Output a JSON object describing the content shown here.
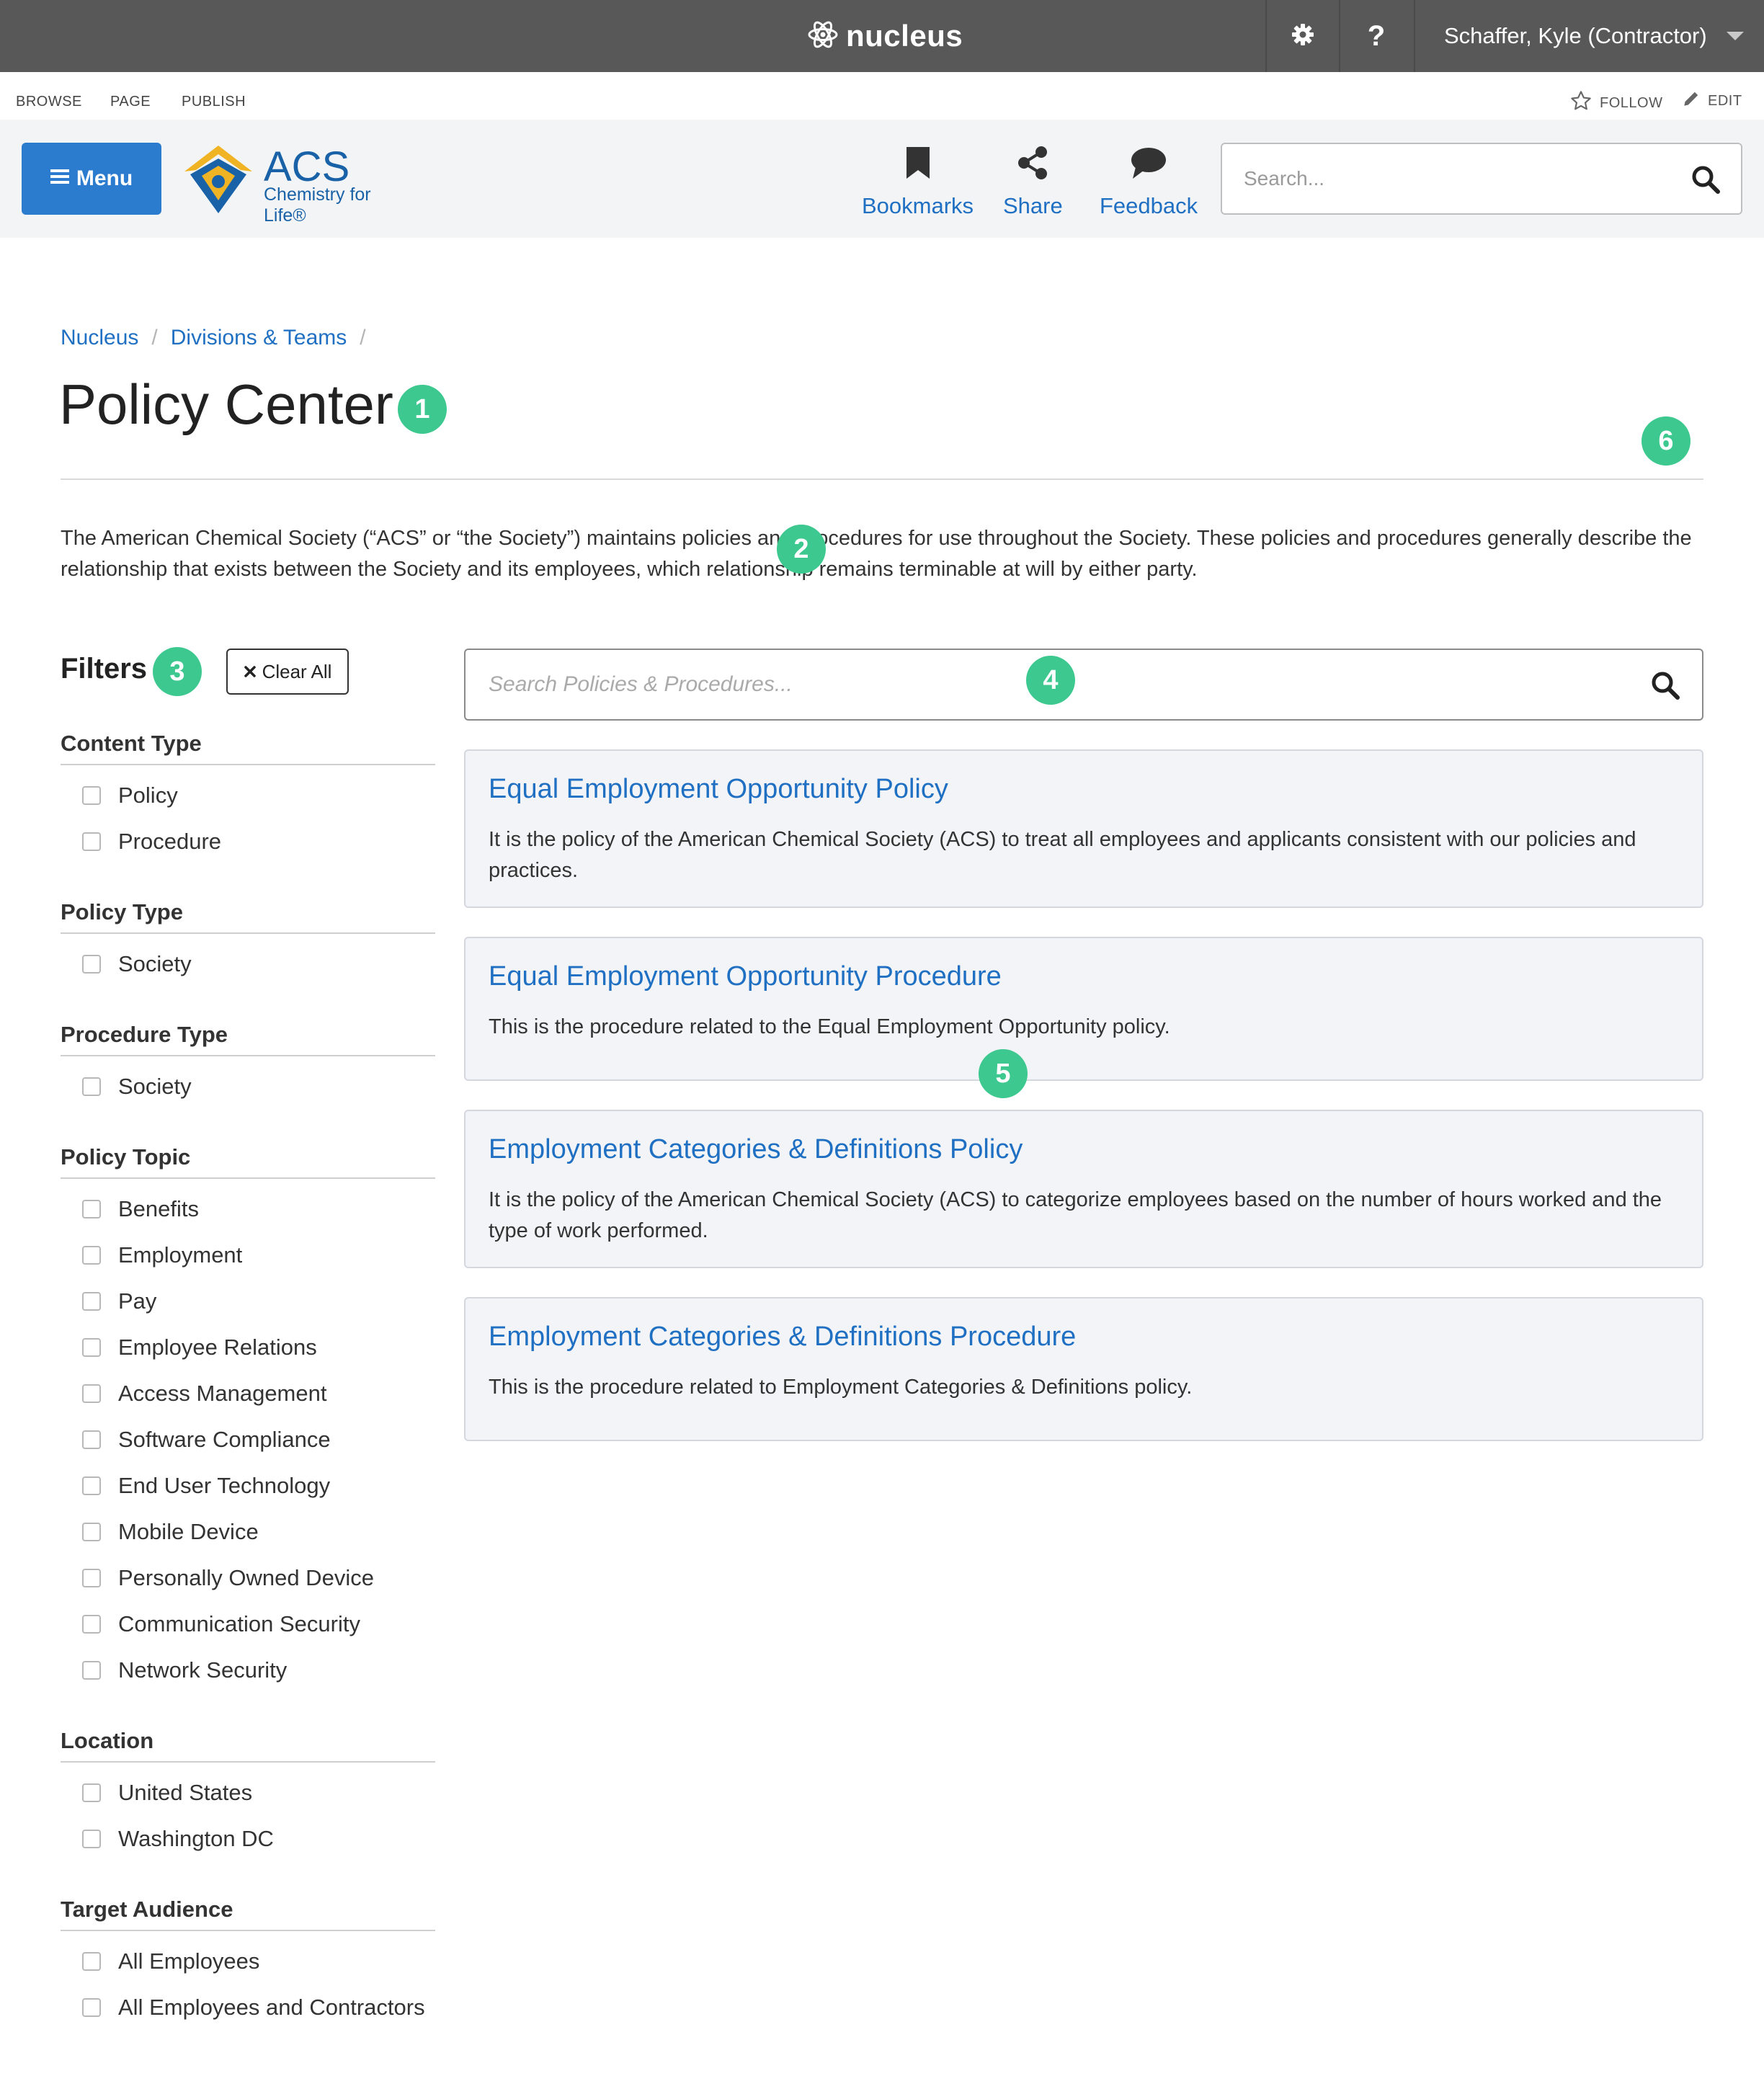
{
  "topbar": {
    "brand": "nucleus",
    "user": "Schaffer, Kyle (Contractor)"
  },
  "ribbon": {
    "browse": "BROWSE",
    "page": "PAGE",
    "publish": "PUBLISH",
    "follow": "FOLLOW",
    "edit": "EDIT"
  },
  "header": {
    "menu_label": "Menu",
    "logo_name": "ACS",
    "logo_tagline": "Chemistry for Life®",
    "bookmarks": "Bookmarks",
    "share": "Share",
    "feedback": "Feedback",
    "search_placeholder": "Search..."
  },
  "breadcrumb": [
    "Nucleus",
    "Divisions & Teams"
  ],
  "page": {
    "title": "Policy Center",
    "intro": "The American Chemical Society (“ACS” or “the Society”) maintains policies and procedures for use throughout the Society. These policies and procedures generally describe the relationship that exists between the Society and its employees, which relationship remains terminable at will by either party."
  },
  "badges": [
    "1",
    "2",
    "3",
    "4",
    "5",
    "6"
  ],
  "filters": {
    "title": "Filters",
    "clear_all": "Clear All",
    "groups": [
      {
        "title": "Content Type",
        "options": [
          "Policy",
          "Procedure"
        ]
      },
      {
        "title": "Policy Type",
        "options": [
          "Society"
        ]
      },
      {
        "title": "Procedure Type",
        "options": [
          "Society"
        ]
      },
      {
        "title": "Policy Topic",
        "options": [
          "Benefits",
          "Employment",
          "Pay",
          "Employee Relations",
          "Access Management",
          "Software Compliance",
          "End User Technology",
          "Mobile Device",
          "Personally Owned Device",
          "Communication Security",
          "Network Security"
        ]
      },
      {
        "title": "Location",
        "options": [
          "United States",
          "Washington DC"
        ]
      },
      {
        "title": "Target Audience",
        "options": [
          "All Employees",
          "All Employees and Contractors"
        ]
      }
    ]
  },
  "policy_search": {
    "placeholder": "Search Policies & Procedures..."
  },
  "results": [
    {
      "title": "Equal Employment Opportunity Policy",
      "description": "It is the policy of the American Chemical Society (ACS) to treat all employees and applicants consistent with our policies and practices."
    },
    {
      "title": "Equal Employment Opportunity Procedure",
      "description": "This is the procedure related to the Equal Employment Opportunity policy."
    },
    {
      "title": "Employment Categories & Definitions Policy",
      "description": "It is the policy of the American Chemical Society (ACS) to categorize employees based on the number of hours worked and the type of work performed."
    },
    {
      "title": "Employment Categories & Definitions Procedure",
      "description": "This is the procedure related to Employment Categories & Definitions policy."
    }
  ],
  "colors": {
    "topbar": "#585858",
    "link_blue": "#1f6fc3",
    "menu_button": "#2b7bcf",
    "badge_green": "#3cc88f",
    "card_bg": "#f2f4f7"
  }
}
